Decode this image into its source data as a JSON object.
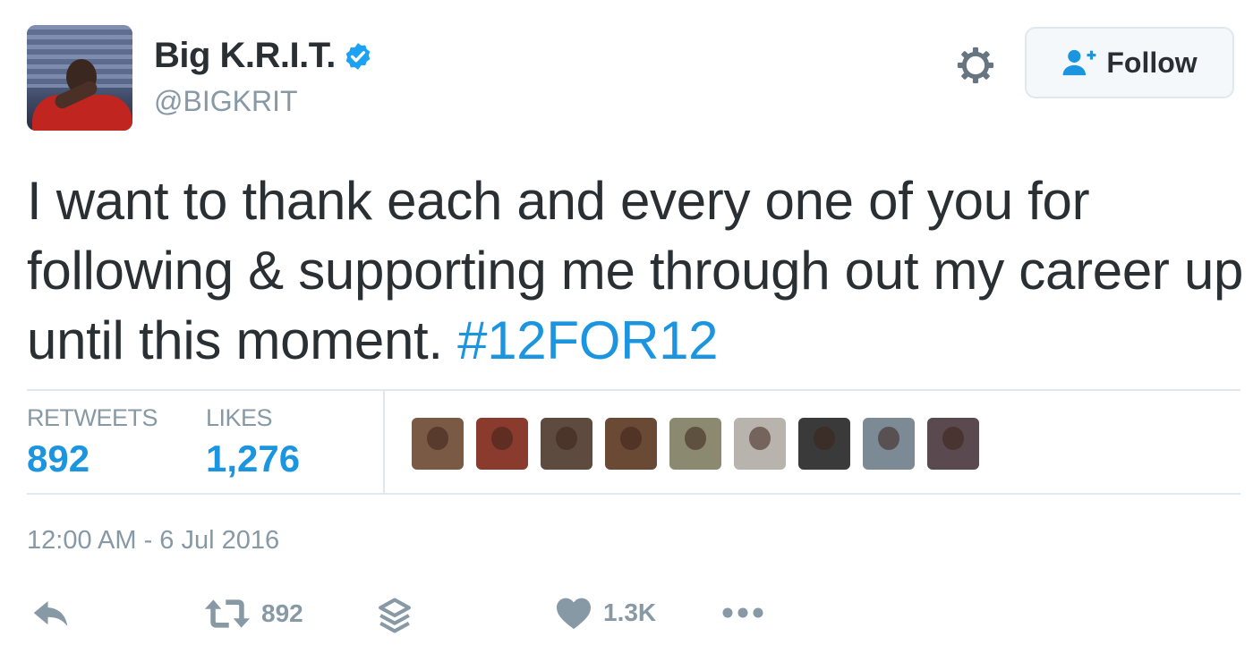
{
  "user": {
    "display_name": "Big K.R.I.T.",
    "handle": "@BIGKRIT",
    "verified": true,
    "verified_color": "#1da1f2"
  },
  "header": {
    "settings_icon": "gear-icon",
    "follow_label": "Follow",
    "follow_icon": "person-add-icon"
  },
  "tweet": {
    "text": "I want to thank each and every one of you for following & supporting me through out my career up until this moment. ",
    "hashtag": "#12FOR12",
    "hashtag_color": "#1b95e0"
  },
  "stats": {
    "retweets_label": "RETWEETS",
    "retweets_value": "892",
    "likes_label": "LIKES",
    "likes_value": "1,276",
    "value_color": "#1b95e0"
  },
  "likers": [
    {
      "icon": "liker-avatar",
      "color": "#7a5a45"
    },
    {
      "icon": "liker-avatar",
      "color": "#8a3b2e"
    },
    {
      "icon": "liker-avatar",
      "color": "#5d4b3f"
    },
    {
      "icon": "liker-avatar",
      "color": "#6b4a35"
    },
    {
      "icon": "liker-avatar",
      "color": "#8b8a70"
    },
    {
      "icon": "liker-avatar",
      "color": "#b9b3ad"
    },
    {
      "icon": "liker-avatar",
      "color": "#3a3a3a"
    },
    {
      "icon": "liker-avatar",
      "color": "#7c8a95"
    },
    {
      "icon": "liker-avatar",
      "color": "#5a4a50"
    }
  ],
  "timestamp": "12:00 AM - 6 Jul 2016",
  "actions": {
    "reply_icon": "reply-icon",
    "retweet_icon": "retweet-icon",
    "retweet_count": "892",
    "buffer_icon": "layers-icon",
    "like_icon": "heart-icon",
    "like_count": "1.3K",
    "more_icon": "more-icon"
  }
}
